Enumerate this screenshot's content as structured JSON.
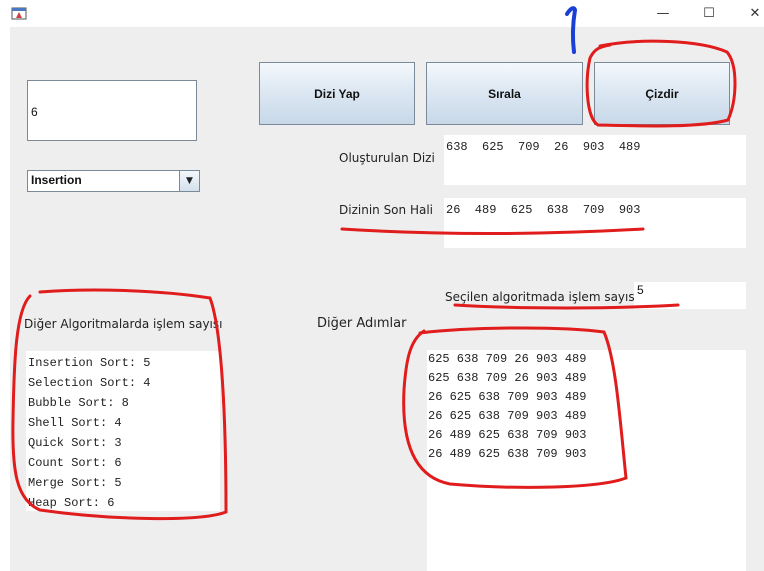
{
  "window": {
    "minimize_glyph": "—",
    "maximize_glyph": "☐",
    "close_glyph": "✕",
    "app_icon": "java-app-icon"
  },
  "input": {
    "value": "6"
  },
  "combo": {
    "selected": "Insertion",
    "arrow_glyph": "▼"
  },
  "buttons": {
    "make_array": "Dizi Yap",
    "sort": "Sırala",
    "draw": "Çizdir"
  },
  "labels": {
    "created_array": "Oluşturulan Dizi",
    "final_array": "Dizinin Son Hali",
    "selected_ops": "Seçilen algoritmada işlem sayısı",
    "other_algorithms": "Diğer Algoritmalarda işlem sayısı",
    "other_steps": "Diğer Adımlar"
  },
  "values": {
    "created_array": "638  625  709  26  903  489",
    "final_array": "26  489  625  638  709  903",
    "selected_ops": "5"
  },
  "algorithm_counts": [
    "Insertion Sort: 5",
    "Selection Sort: 4",
    "Bubble Sort: 8",
    "Shell Sort: 4",
    "Quick Sort: 3",
    "Count Sort: 6",
    "Merge Sort: 5",
    "Heap Sort: 6"
  ],
  "steps": [
    "625 638 709 26 903 489",
    "625 638 709 26 903 489",
    "26 625 638 709 903 489",
    "26 625 638 709 903 489",
    "26 489 625 638 709 903",
    "26 489 625 638 709 903"
  ],
  "annotation": {
    "handwritten_number": "1",
    "mark_color_red": "#e01c1c",
    "mark_color_blue": "#1a3fd6"
  }
}
